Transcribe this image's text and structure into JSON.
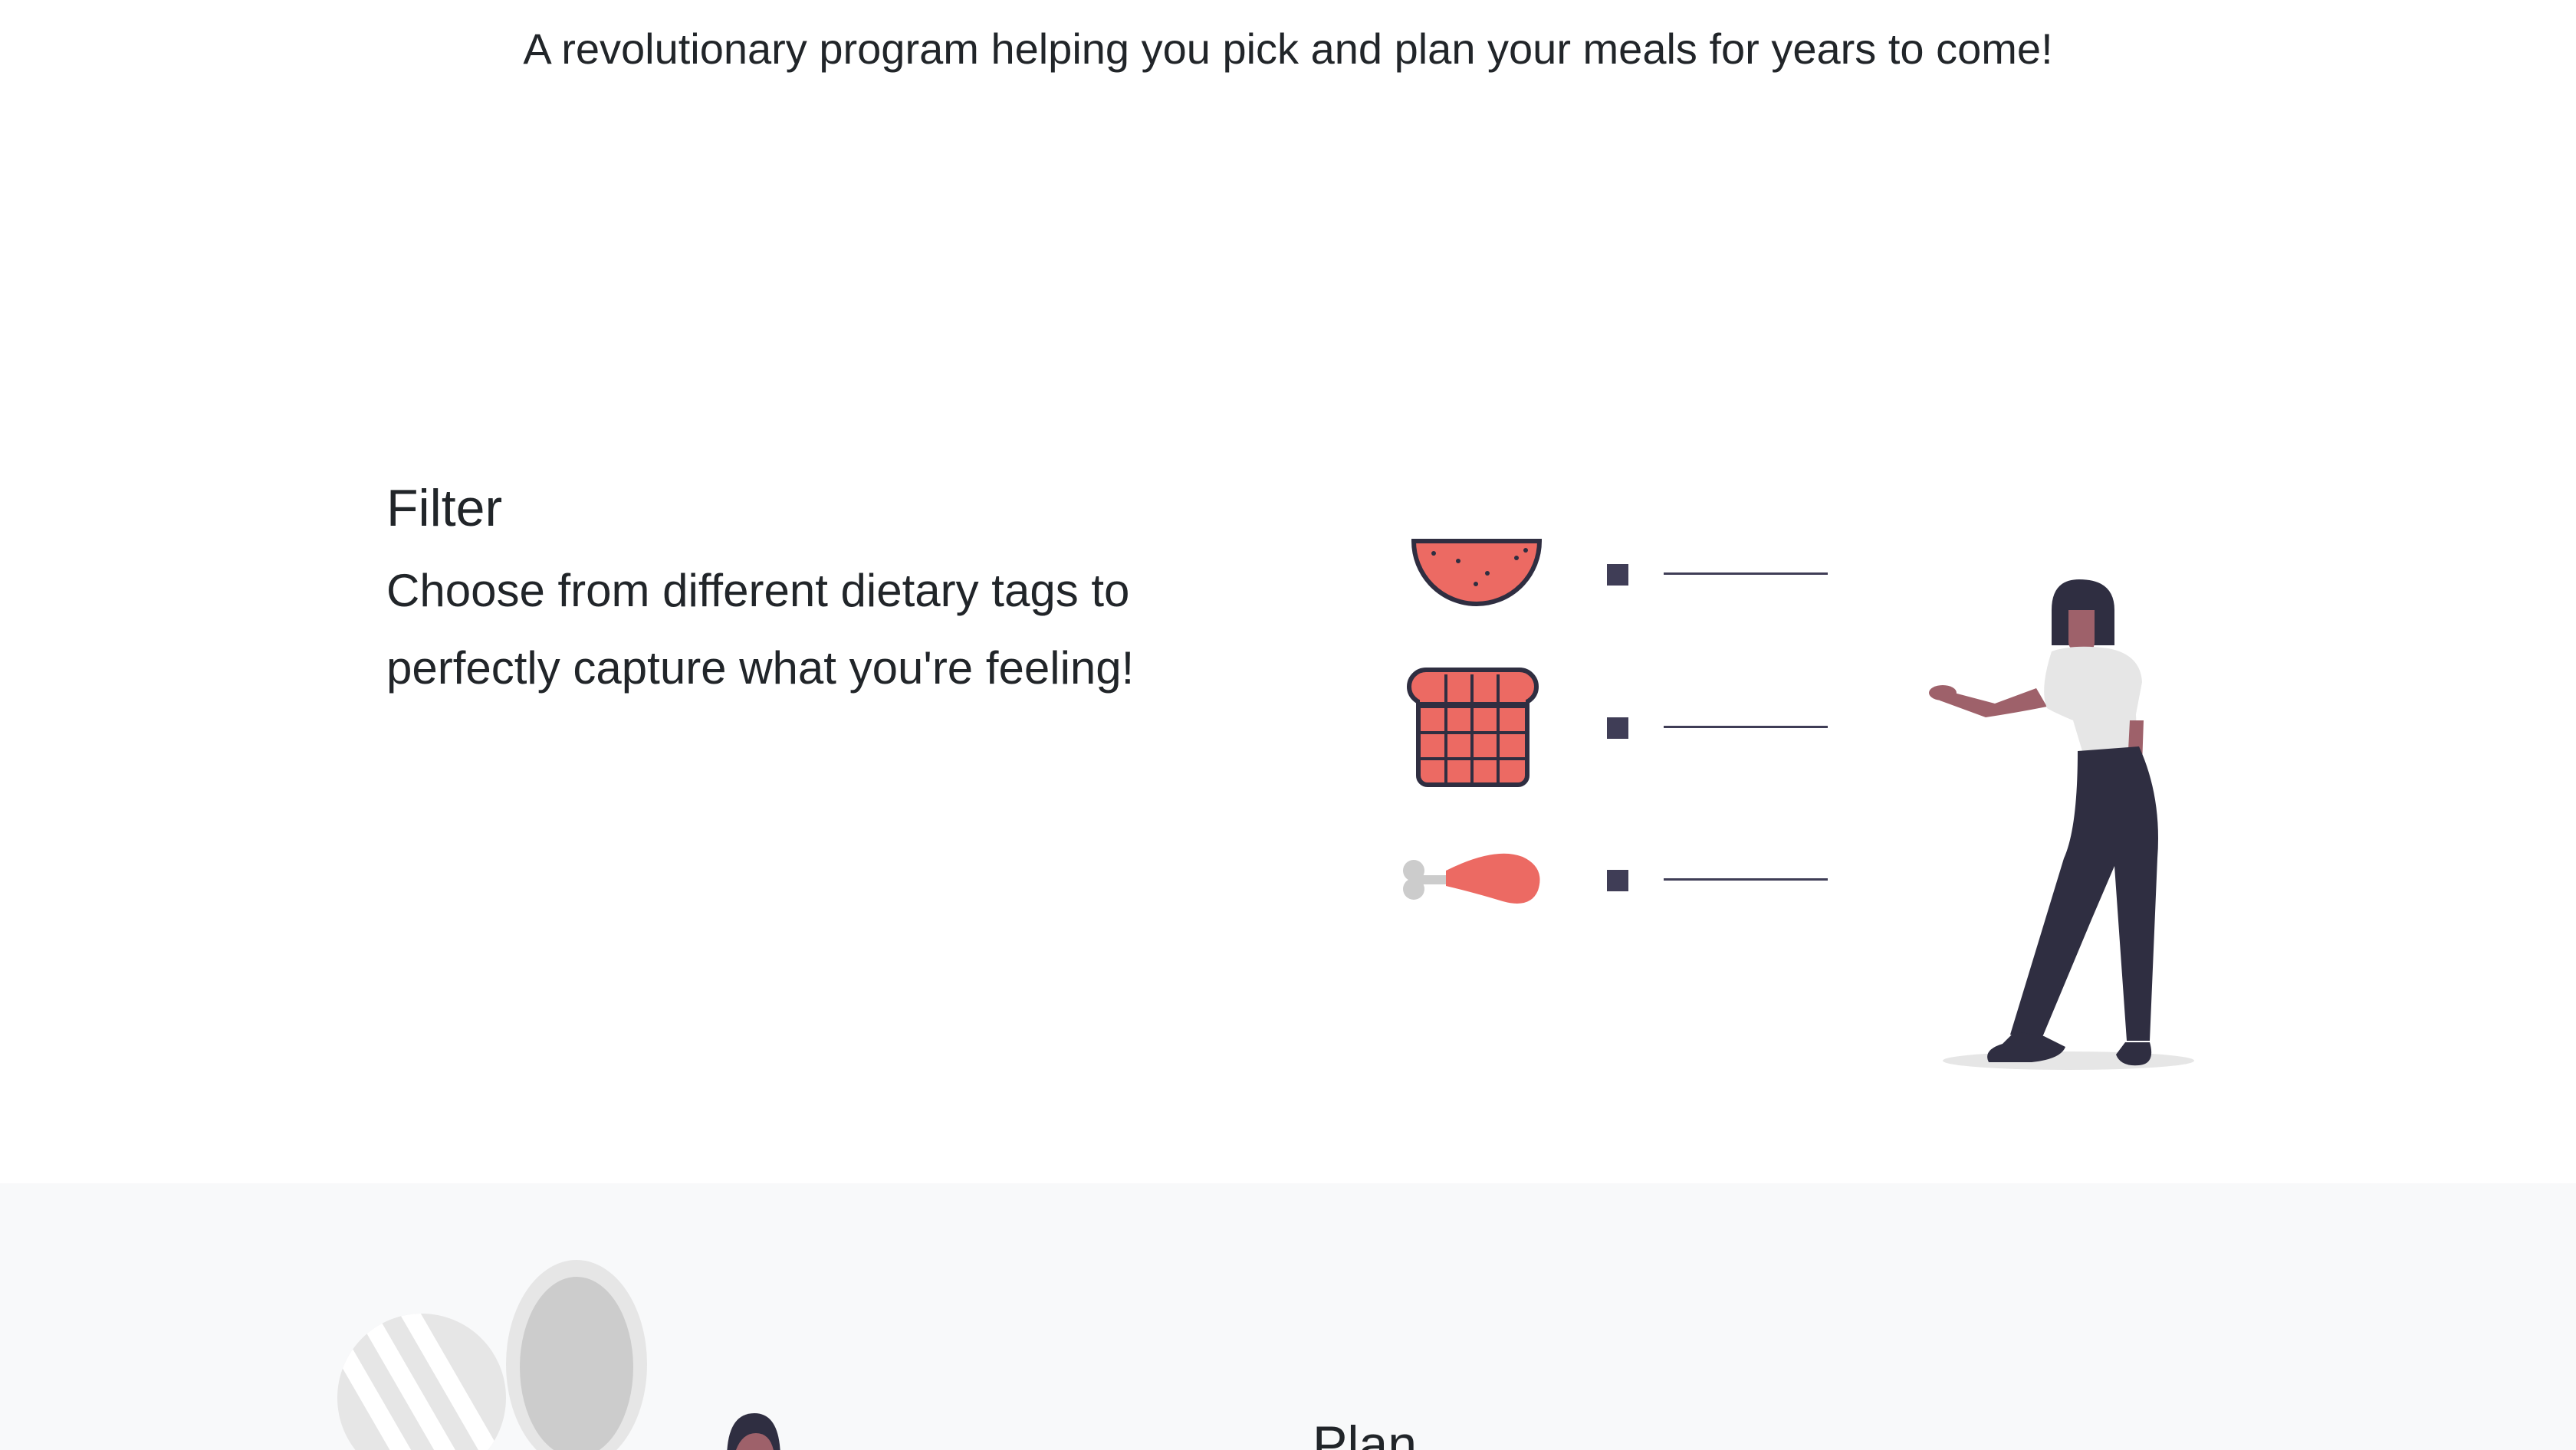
{
  "hero": {
    "tagline": "A revolutionary program helping you pick and plan your meals for years to come!"
  },
  "filter": {
    "title": "Filter",
    "description": "Choose from different dietary tags to perfectly capture what you're feeling!",
    "illustration": {
      "icons": [
        "watermelon-icon",
        "bread-icon",
        "chicken-leg-icon"
      ],
      "accent": "#ec6a63",
      "dark": "#2f2e41",
      "light": "#e6e6e6"
    }
  },
  "plan": {
    "title": "Plan"
  },
  "colors": {
    "text": "#212529",
    "section_alt_bg": "#f8f9fa"
  }
}
